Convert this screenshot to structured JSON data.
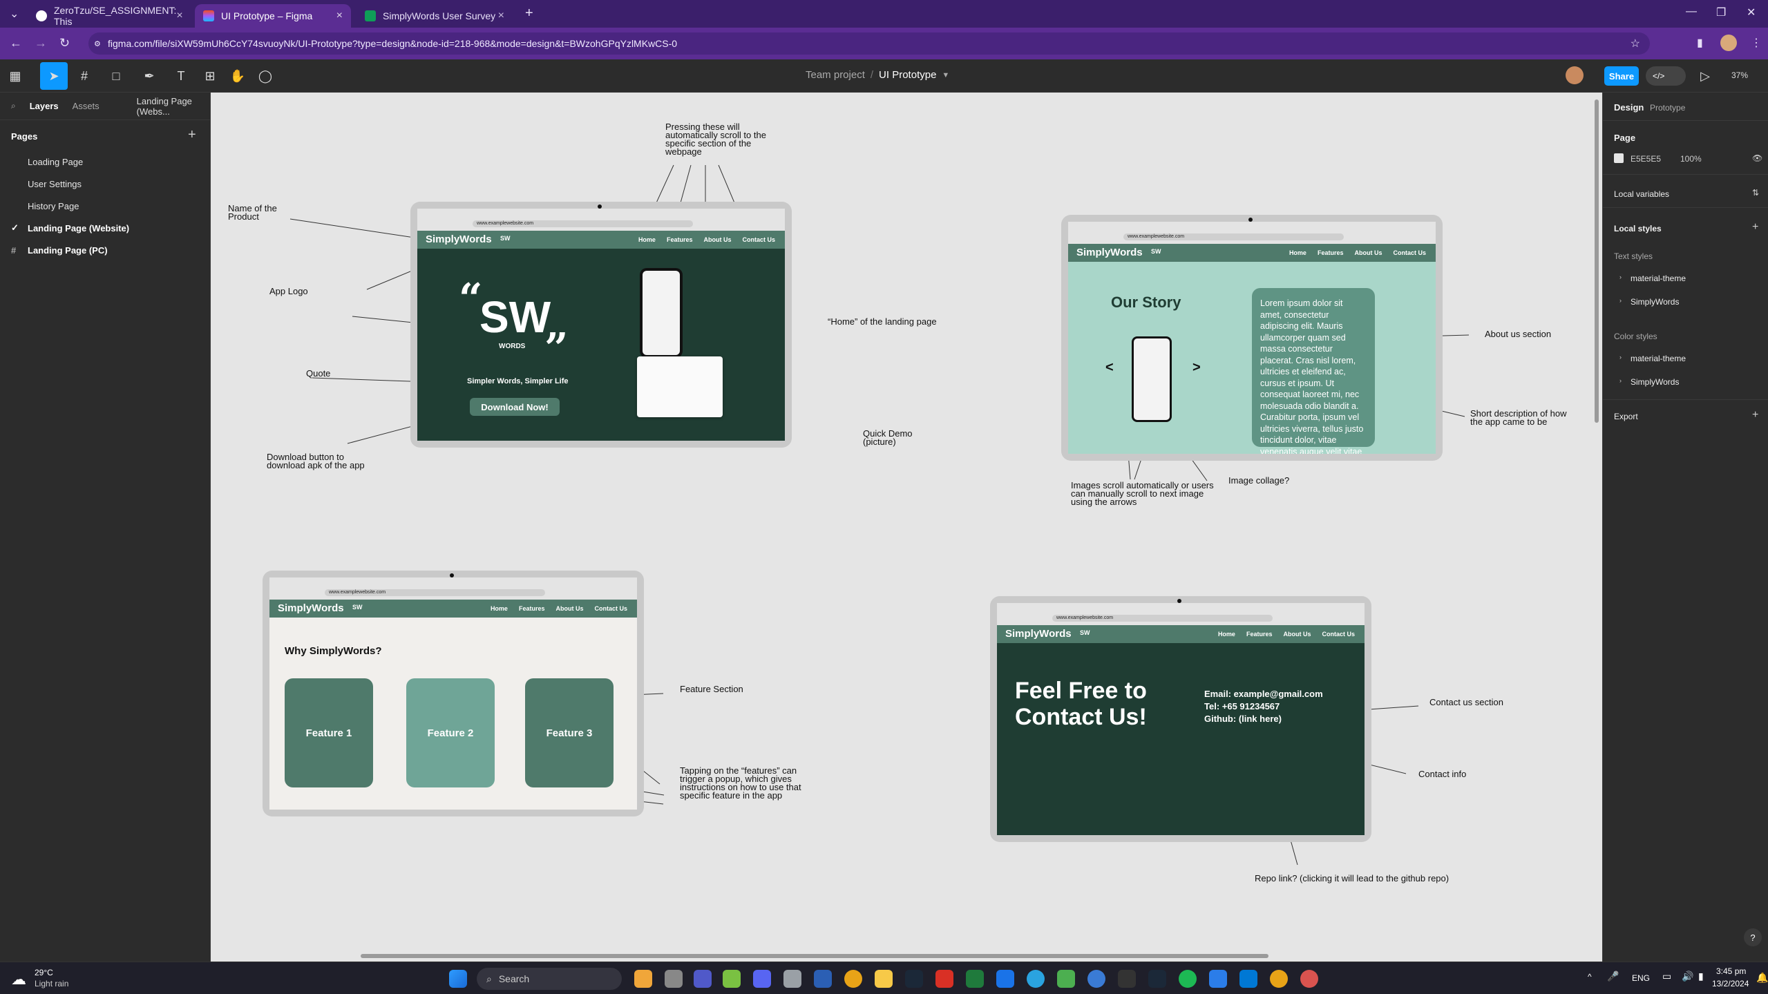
{
  "browser": {
    "tabs": [
      {
        "label": "ZeroTzu/SE_ASSIGNMENT: This"
      },
      {
        "label": "UI Prototype – Figma"
      },
      {
        "label": "SimplyWords User Survey"
      }
    ],
    "url": "figma.com/file/siXW59mUh6CcY74svuoyNk/UI-Prototype?type=design&node-id=218-968&mode=design&t=BWzohGPqYzlMKwCS-0"
  },
  "figma": {
    "breadcrumb_team": "Team project",
    "breadcrumb_sep": "/",
    "file_name": "UI Prototype",
    "share_label": "Share",
    "zoom": "37%",
    "left_tabs": {
      "layers": "Layers",
      "assets": "Assets",
      "page_dropdown": "Landing Page (Webs..."
    },
    "pages_header": "Pages",
    "pages": [
      "Loading Page",
      "User Settings",
      "History Page",
      "Landing Page (Website)",
      "Landing Page (PC)"
    ],
    "right_tabs": {
      "design": "Design",
      "prototype": "Prototype"
    },
    "page_section": "Page",
    "page_color": "E5E5E5",
    "page_opacity": "100%",
    "local_variables": "Local variables",
    "local_styles": "Local styles",
    "text_styles": "Text styles",
    "text_style_items": [
      "material-theme",
      "SimplyWords"
    ],
    "color_styles": "Color styles",
    "color_style_items": [
      "material-theme",
      "SimplyWords"
    ],
    "export": "Export",
    "help": "?"
  },
  "canvas": {
    "browser_url": "www.examplewebsite.com",
    "brand": "SimplyWords",
    "logo_small": "SW",
    "nav_links": [
      "Home",
      "Features",
      "About Us",
      "Contact Us"
    ],
    "frame1": {
      "logo": "SW",
      "logo_sub": "WORDS",
      "quote_open": "“",
      "quote_close": "”",
      "tagline": "Simpler Words, Simpler Life",
      "download": "Download Now!"
    },
    "frame2": {
      "title": "Our Story",
      "lorem": "Lorem ipsum dolor sit amet, consectetur adipiscing elit. Mauris ullamcorper quam sed massa consectetur placerat. Cras nisl lorem, ultricies et eleifend ac, cursus et ipsum. Ut consequat laoreet mi, nec molesuada odio blandit a. Curabitur porta, ipsum vel ultricies viverra, tellus justo tincidunt dolor, vitae venenatis augue velit vitae dui.",
      "arrow_left": "<",
      "arrow_right": ">"
    },
    "frame3": {
      "title": "Why SimplyWords?",
      "features": [
        "Feature 1",
        "Feature 2",
        "Feature 3"
      ]
    },
    "frame4": {
      "headline_1": "Feel Free to",
      "headline_2": "Contact Us!",
      "email": "Email: example@gmail.com",
      "tel": "Tel: +65 91234567",
      "github": "Github: (link here)"
    },
    "notes": {
      "pressing": "Pressing these will automatically scroll to the specific section of the webpage",
      "name_of_product": "Name of the Product",
      "app_logo": "App Logo",
      "quote": "Quote",
      "download": "Download button to download apk of the app",
      "home": "“Home” of the landing page",
      "quick_demo": "Quick Demo (picture)",
      "about_us": "About us section",
      "short_desc": "Short description of how the app came to be",
      "images_scroll": "Images scroll automatically or users can manually scroll to next image using the arrows",
      "image_collage": "Image collage?",
      "feature_section": "Feature Section",
      "tapping": "Tapping on the “features” can trigger a popup, which gives instructions on how to use that specific feature in the app",
      "contact_section": "Contact us section",
      "contact_info": "Contact info",
      "repo_link": "Repo link? (clicking it will lead to the github repo)"
    }
  },
  "taskbar": {
    "weather_temp": "29°C",
    "weather_desc": "Light rain",
    "search": "Search",
    "lang": "ENG",
    "time": "3:45 pm",
    "date": "13/2/2024"
  },
  "colors": {
    "brand_dark": "#1f3d33",
    "brand_mid": "#4f7a6b",
    "brand_light": "#6fa597",
    "figma_blue": "#0d99ff",
    "chrome_purple": "#5b2d93"
  }
}
